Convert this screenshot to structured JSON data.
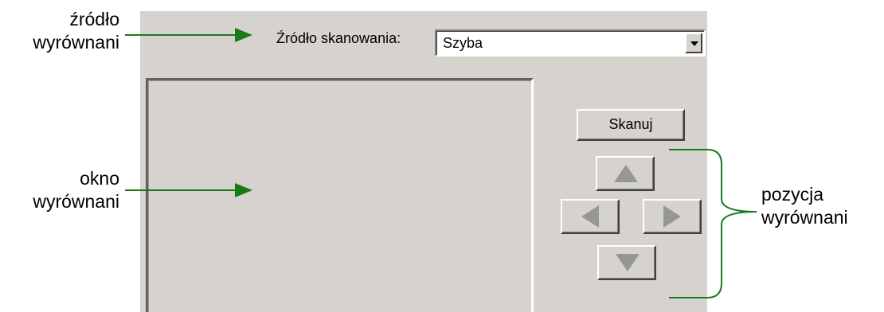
{
  "callouts": {
    "source": [
      "źródło",
      "wyrównani"
    ],
    "window": [
      "okno",
      "wyrównani"
    ],
    "position": [
      "pozycja",
      "wyrównani"
    ]
  },
  "form": {
    "source_label": "Źródło skanowania:",
    "source_value": "Szyba",
    "scan_button": "Skanuj"
  },
  "icons": {
    "dropdown": "chevron-down-icon",
    "up": "arrow-up-icon",
    "down": "arrow-down-icon",
    "left": "arrow-left-icon",
    "right": "arrow-right-icon"
  },
  "colors": {
    "panel": "#d6d3ce",
    "callout_line": "#1a7a1a"
  }
}
